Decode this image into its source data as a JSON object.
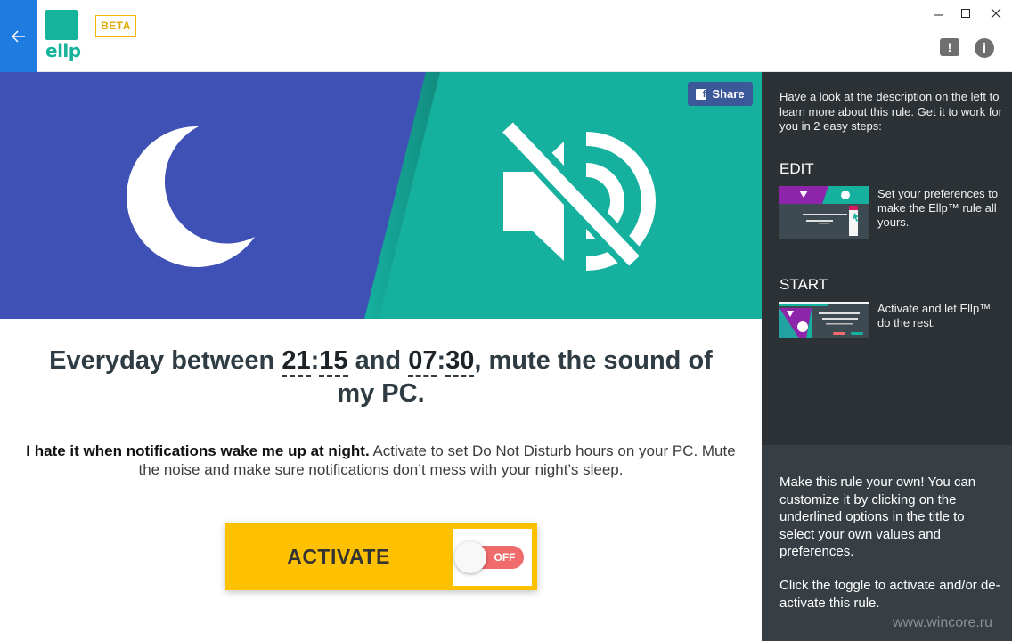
{
  "app": {
    "logo_text": "ellp",
    "beta_label": "BETA"
  },
  "hero": {
    "left_color": "#3f51b5",
    "right_color": "#16b09f",
    "share_label": "Share"
  },
  "rule": {
    "prefix": "Everyday between ",
    "start_hour": "21",
    "start_min": "15",
    "middle": " and ",
    "end_hour": "07",
    "end_min": "30",
    "suffix_line1": ", mute the sound of",
    "suffix_line2": "my PC.",
    "description_bold": "I hate it when notifications wake me up at night.",
    "description_rest": " Activate to set Do Not Disturb hours on your PC. Mute the noise and make sure notifications don’t mess with your night’s sleep."
  },
  "activate": {
    "label": "ACTIVATE",
    "toggle_state": "OFF"
  },
  "sidebar": {
    "intro": "Have a look at the description on the left to learn more about this rule. Get it to work for you in 2 easy steps:",
    "steps": [
      {
        "title": "EDIT",
        "text": "Set your preferences to make the Ellp™ rule all yours."
      },
      {
        "title": "START",
        "text": "Activate and let Ellp™ do the rest."
      }
    ],
    "help_1": "Make this rule your own! You can customize it by clicking on the underlined options in the title to select your own values and preferences.",
    "help_2": "Click the toggle to activate and/or de-activate this rule."
  },
  "watermark": "www.wincore.ru"
}
